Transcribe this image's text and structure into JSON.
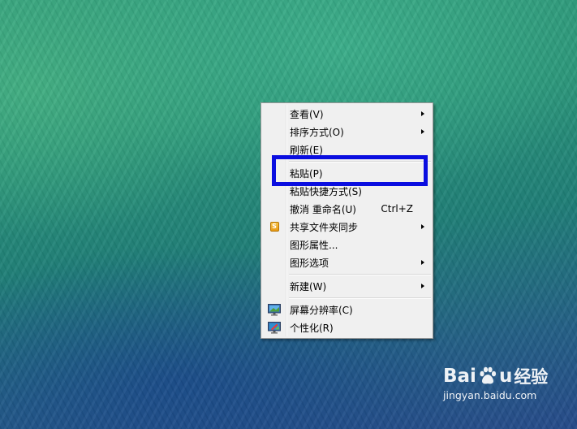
{
  "menu": {
    "items": [
      {
        "label": "查看(V)",
        "submenu": true
      },
      {
        "label": "排序方式(O)",
        "submenu": true
      },
      {
        "label": "刷新(E)"
      },
      {
        "label": "粘贴(P)"
      },
      {
        "label": "粘贴快捷方式(S)"
      },
      {
        "label": "撤消 重命名(U)",
        "shortcut": "Ctrl+Z"
      },
      {
        "label": "共享文件夹同步",
        "submenu": true,
        "icon": "share-sync-icon",
        "icon_glyph": "S"
      },
      {
        "label": "图形属性..."
      },
      {
        "label": "图形选项",
        "submenu": true
      },
      {
        "label": "新建(W)",
        "submenu": true
      },
      {
        "label": "屏幕分辨率(C)",
        "icon": "screen-resolution-icon"
      },
      {
        "label": "个性化(R)",
        "icon": "personalize-icon"
      }
    ]
  },
  "highlight": {
    "target": "粘贴(P)",
    "color": "#0a0ee0"
  },
  "watermark": {
    "brand_latin_1": "Bai",
    "brand_latin_2": "u",
    "brand_cn": "经验",
    "url": "jingyan.baidu.com"
  },
  "colors": {
    "menu_bg": "#f0f0f0",
    "menu_border": "#979797",
    "highlight_border": "#0a0ee0"
  }
}
